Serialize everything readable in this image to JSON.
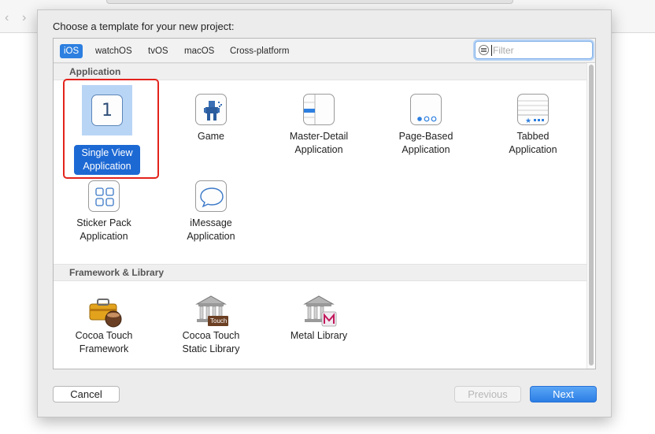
{
  "dialog": {
    "title": "Choose a template for your new project:"
  },
  "platform_tabs": [
    {
      "label": "iOS",
      "active": true
    },
    {
      "label": "watchOS",
      "active": false
    },
    {
      "label": "tvOS",
      "active": false
    },
    {
      "label": "macOS",
      "active": false
    },
    {
      "label": "Cross-platform",
      "active": false
    }
  ],
  "filter": {
    "placeholder": "Filter",
    "value": ""
  },
  "sections": [
    {
      "title": "Application",
      "templates": [
        {
          "label": "Single View\nApplication",
          "icon": "single-view-icon",
          "selected": true
        },
        {
          "label": "Game",
          "icon": "game-icon",
          "selected": false
        },
        {
          "label": "Master-Detail\nApplication",
          "icon": "master-detail-icon",
          "selected": false
        },
        {
          "label": "Page-Based\nApplication",
          "icon": "page-based-icon",
          "selected": false
        },
        {
          "label": "Tabbed\nApplication",
          "icon": "tabbed-icon",
          "selected": false
        },
        {
          "label": "Sticker Pack\nApplication",
          "icon": "sticker-pack-icon",
          "selected": false
        },
        {
          "label": "iMessage\nApplication",
          "icon": "imessage-icon",
          "selected": false
        }
      ]
    },
    {
      "title": "Framework & Library",
      "templates": [
        {
          "label": "Cocoa Touch\nFramework",
          "icon": "toolbox-icon",
          "selected": false
        },
        {
          "label": "Cocoa Touch\nStatic Library",
          "icon": "static-library-icon",
          "selected": false,
          "badge": "Touch"
        },
        {
          "label": "Metal Library",
          "icon": "metal-library-icon",
          "selected": false
        }
      ]
    }
  ],
  "single_view_glyph": "1",
  "buttons": {
    "cancel": "Cancel",
    "previous": "Previous",
    "next": "Next"
  },
  "colors": {
    "accent": "#2d7fe0",
    "selection": "#1d69d4",
    "highlight_outline": "#e3231c"
  }
}
